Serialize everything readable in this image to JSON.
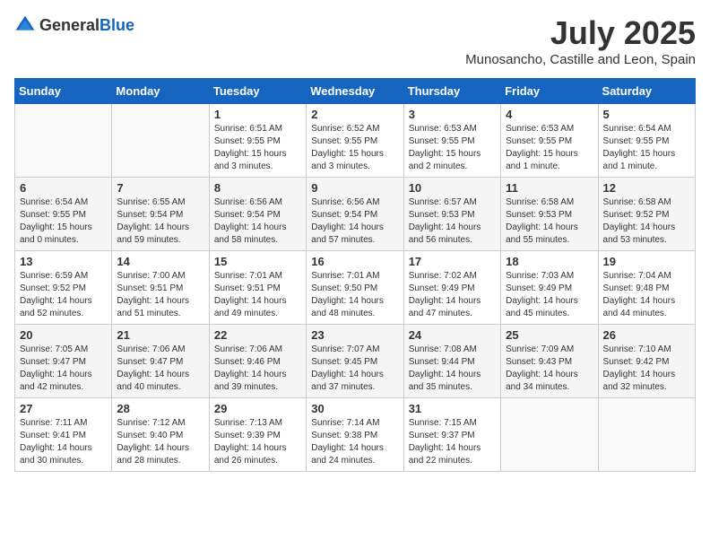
{
  "logo": {
    "general": "General",
    "blue": "Blue"
  },
  "title": {
    "month_year": "July 2025",
    "location": "Munosancho, Castille and Leon, Spain"
  },
  "days_of_week": [
    "Sunday",
    "Monday",
    "Tuesday",
    "Wednesday",
    "Thursday",
    "Friday",
    "Saturday"
  ],
  "weeks": [
    [
      {
        "day": "",
        "sunrise": "",
        "sunset": "",
        "daylight": ""
      },
      {
        "day": "",
        "sunrise": "",
        "sunset": "",
        "daylight": ""
      },
      {
        "day": "1",
        "sunrise": "Sunrise: 6:51 AM",
        "sunset": "Sunset: 9:55 PM",
        "daylight": "Daylight: 15 hours and 3 minutes."
      },
      {
        "day": "2",
        "sunrise": "Sunrise: 6:52 AM",
        "sunset": "Sunset: 9:55 PM",
        "daylight": "Daylight: 15 hours and 3 minutes."
      },
      {
        "day": "3",
        "sunrise": "Sunrise: 6:53 AM",
        "sunset": "Sunset: 9:55 PM",
        "daylight": "Daylight: 15 hours and 2 minutes."
      },
      {
        "day": "4",
        "sunrise": "Sunrise: 6:53 AM",
        "sunset": "Sunset: 9:55 PM",
        "daylight": "Daylight: 15 hours and 1 minute."
      },
      {
        "day": "5",
        "sunrise": "Sunrise: 6:54 AM",
        "sunset": "Sunset: 9:55 PM",
        "daylight": "Daylight: 15 hours and 1 minute."
      }
    ],
    [
      {
        "day": "6",
        "sunrise": "Sunrise: 6:54 AM",
        "sunset": "Sunset: 9:55 PM",
        "daylight": "Daylight: 15 hours and 0 minutes."
      },
      {
        "day": "7",
        "sunrise": "Sunrise: 6:55 AM",
        "sunset": "Sunset: 9:54 PM",
        "daylight": "Daylight: 14 hours and 59 minutes."
      },
      {
        "day": "8",
        "sunrise": "Sunrise: 6:56 AM",
        "sunset": "Sunset: 9:54 PM",
        "daylight": "Daylight: 14 hours and 58 minutes."
      },
      {
        "day": "9",
        "sunrise": "Sunrise: 6:56 AM",
        "sunset": "Sunset: 9:54 PM",
        "daylight": "Daylight: 14 hours and 57 minutes."
      },
      {
        "day": "10",
        "sunrise": "Sunrise: 6:57 AM",
        "sunset": "Sunset: 9:53 PM",
        "daylight": "Daylight: 14 hours and 56 minutes."
      },
      {
        "day": "11",
        "sunrise": "Sunrise: 6:58 AM",
        "sunset": "Sunset: 9:53 PM",
        "daylight": "Daylight: 14 hours and 55 minutes."
      },
      {
        "day": "12",
        "sunrise": "Sunrise: 6:58 AM",
        "sunset": "Sunset: 9:52 PM",
        "daylight": "Daylight: 14 hours and 53 minutes."
      }
    ],
    [
      {
        "day": "13",
        "sunrise": "Sunrise: 6:59 AM",
        "sunset": "Sunset: 9:52 PM",
        "daylight": "Daylight: 14 hours and 52 minutes."
      },
      {
        "day": "14",
        "sunrise": "Sunrise: 7:00 AM",
        "sunset": "Sunset: 9:51 PM",
        "daylight": "Daylight: 14 hours and 51 minutes."
      },
      {
        "day": "15",
        "sunrise": "Sunrise: 7:01 AM",
        "sunset": "Sunset: 9:51 PM",
        "daylight": "Daylight: 14 hours and 49 minutes."
      },
      {
        "day": "16",
        "sunrise": "Sunrise: 7:01 AM",
        "sunset": "Sunset: 9:50 PM",
        "daylight": "Daylight: 14 hours and 48 minutes."
      },
      {
        "day": "17",
        "sunrise": "Sunrise: 7:02 AM",
        "sunset": "Sunset: 9:49 PM",
        "daylight": "Daylight: 14 hours and 47 minutes."
      },
      {
        "day": "18",
        "sunrise": "Sunrise: 7:03 AM",
        "sunset": "Sunset: 9:49 PM",
        "daylight": "Daylight: 14 hours and 45 minutes."
      },
      {
        "day": "19",
        "sunrise": "Sunrise: 7:04 AM",
        "sunset": "Sunset: 9:48 PM",
        "daylight": "Daylight: 14 hours and 44 minutes."
      }
    ],
    [
      {
        "day": "20",
        "sunrise": "Sunrise: 7:05 AM",
        "sunset": "Sunset: 9:47 PM",
        "daylight": "Daylight: 14 hours and 42 minutes."
      },
      {
        "day": "21",
        "sunrise": "Sunrise: 7:06 AM",
        "sunset": "Sunset: 9:47 PM",
        "daylight": "Daylight: 14 hours and 40 minutes."
      },
      {
        "day": "22",
        "sunrise": "Sunrise: 7:06 AM",
        "sunset": "Sunset: 9:46 PM",
        "daylight": "Daylight: 14 hours and 39 minutes."
      },
      {
        "day": "23",
        "sunrise": "Sunrise: 7:07 AM",
        "sunset": "Sunset: 9:45 PM",
        "daylight": "Daylight: 14 hours and 37 minutes."
      },
      {
        "day": "24",
        "sunrise": "Sunrise: 7:08 AM",
        "sunset": "Sunset: 9:44 PM",
        "daylight": "Daylight: 14 hours and 35 minutes."
      },
      {
        "day": "25",
        "sunrise": "Sunrise: 7:09 AM",
        "sunset": "Sunset: 9:43 PM",
        "daylight": "Daylight: 14 hours and 34 minutes."
      },
      {
        "day": "26",
        "sunrise": "Sunrise: 7:10 AM",
        "sunset": "Sunset: 9:42 PM",
        "daylight": "Daylight: 14 hours and 32 minutes."
      }
    ],
    [
      {
        "day": "27",
        "sunrise": "Sunrise: 7:11 AM",
        "sunset": "Sunset: 9:41 PM",
        "daylight": "Daylight: 14 hours and 30 minutes."
      },
      {
        "day": "28",
        "sunrise": "Sunrise: 7:12 AM",
        "sunset": "Sunset: 9:40 PM",
        "daylight": "Daylight: 14 hours and 28 minutes."
      },
      {
        "day": "29",
        "sunrise": "Sunrise: 7:13 AM",
        "sunset": "Sunset: 9:39 PM",
        "daylight": "Daylight: 14 hours and 26 minutes."
      },
      {
        "day": "30",
        "sunrise": "Sunrise: 7:14 AM",
        "sunset": "Sunset: 9:38 PM",
        "daylight": "Daylight: 14 hours and 24 minutes."
      },
      {
        "day": "31",
        "sunrise": "Sunrise: 7:15 AM",
        "sunset": "Sunset: 9:37 PM",
        "daylight": "Daylight: 14 hours and 22 minutes."
      },
      {
        "day": "",
        "sunrise": "",
        "sunset": "",
        "daylight": ""
      },
      {
        "day": "",
        "sunrise": "",
        "sunset": "",
        "daylight": ""
      }
    ]
  ]
}
